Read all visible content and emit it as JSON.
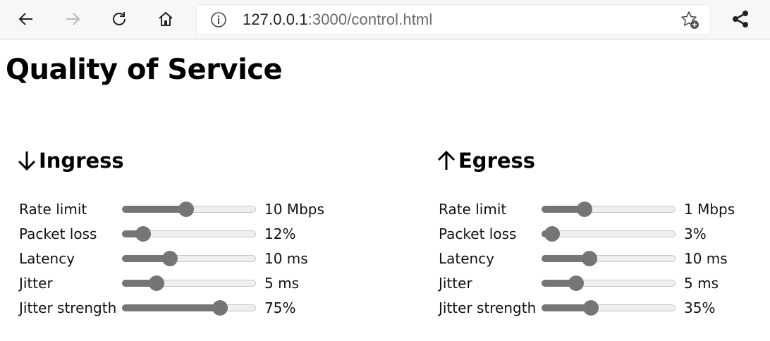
{
  "browser": {
    "url_host": "127.0.0.1",
    "url_rest": ":3000/control.html"
  },
  "page": {
    "title": "Quality of Service"
  },
  "ingress": {
    "heading": "Ingress",
    "controls": [
      {
        "label": "Rate limit",
        "value": "10 Mbps",
        "level": 0.48
      },
      {
        "label": "Packet loss",
        "value": "12%",
        "level": 0.16
      },
      {
        "label": "Latency",
        "value": "10 ms",
        "level": 0.36
      },
      {
        "label": "Jitter",
        "value": "5 ms",
        "level": 0.26
      },
      {
        "label": "Jitter strength",
        "value": "75%",
        "level": 0.73
      }
    ]
  },
  "egress": {
    "heading": "Egress",
    "controls": [
      {
        "label": "Rate limit",
        "value": "1 Mbps",
        "level": 0.32
      },
      {
        "label": "Packet loss",
        "value": "3%",
        "level": 0.08
      },
      {
        "label": "Latency",
        "value": "10 ms",
        "level": 0.36
      },
      {
        "label": "Jitter",
        "value": "5 ms",
        "level": 0.26
      },
      {
        "label": "Jitter strength",
        "value": "35%",
        "level": 0.37
      }
    ]
  },
  "colors": {
    "slider_fill": "#757575",
    "slider_track": "#efefef"
  },
  "icons": [
    "back-arrow-icon",
    "forward-arrow-icon",
    "reload-icon",
    "home-icon",
    "info-icon",
    "add-favorite-icon",
    "share-icon",
    "down-arrow-icon",
    "up-arrow-icon"
  ]
}
